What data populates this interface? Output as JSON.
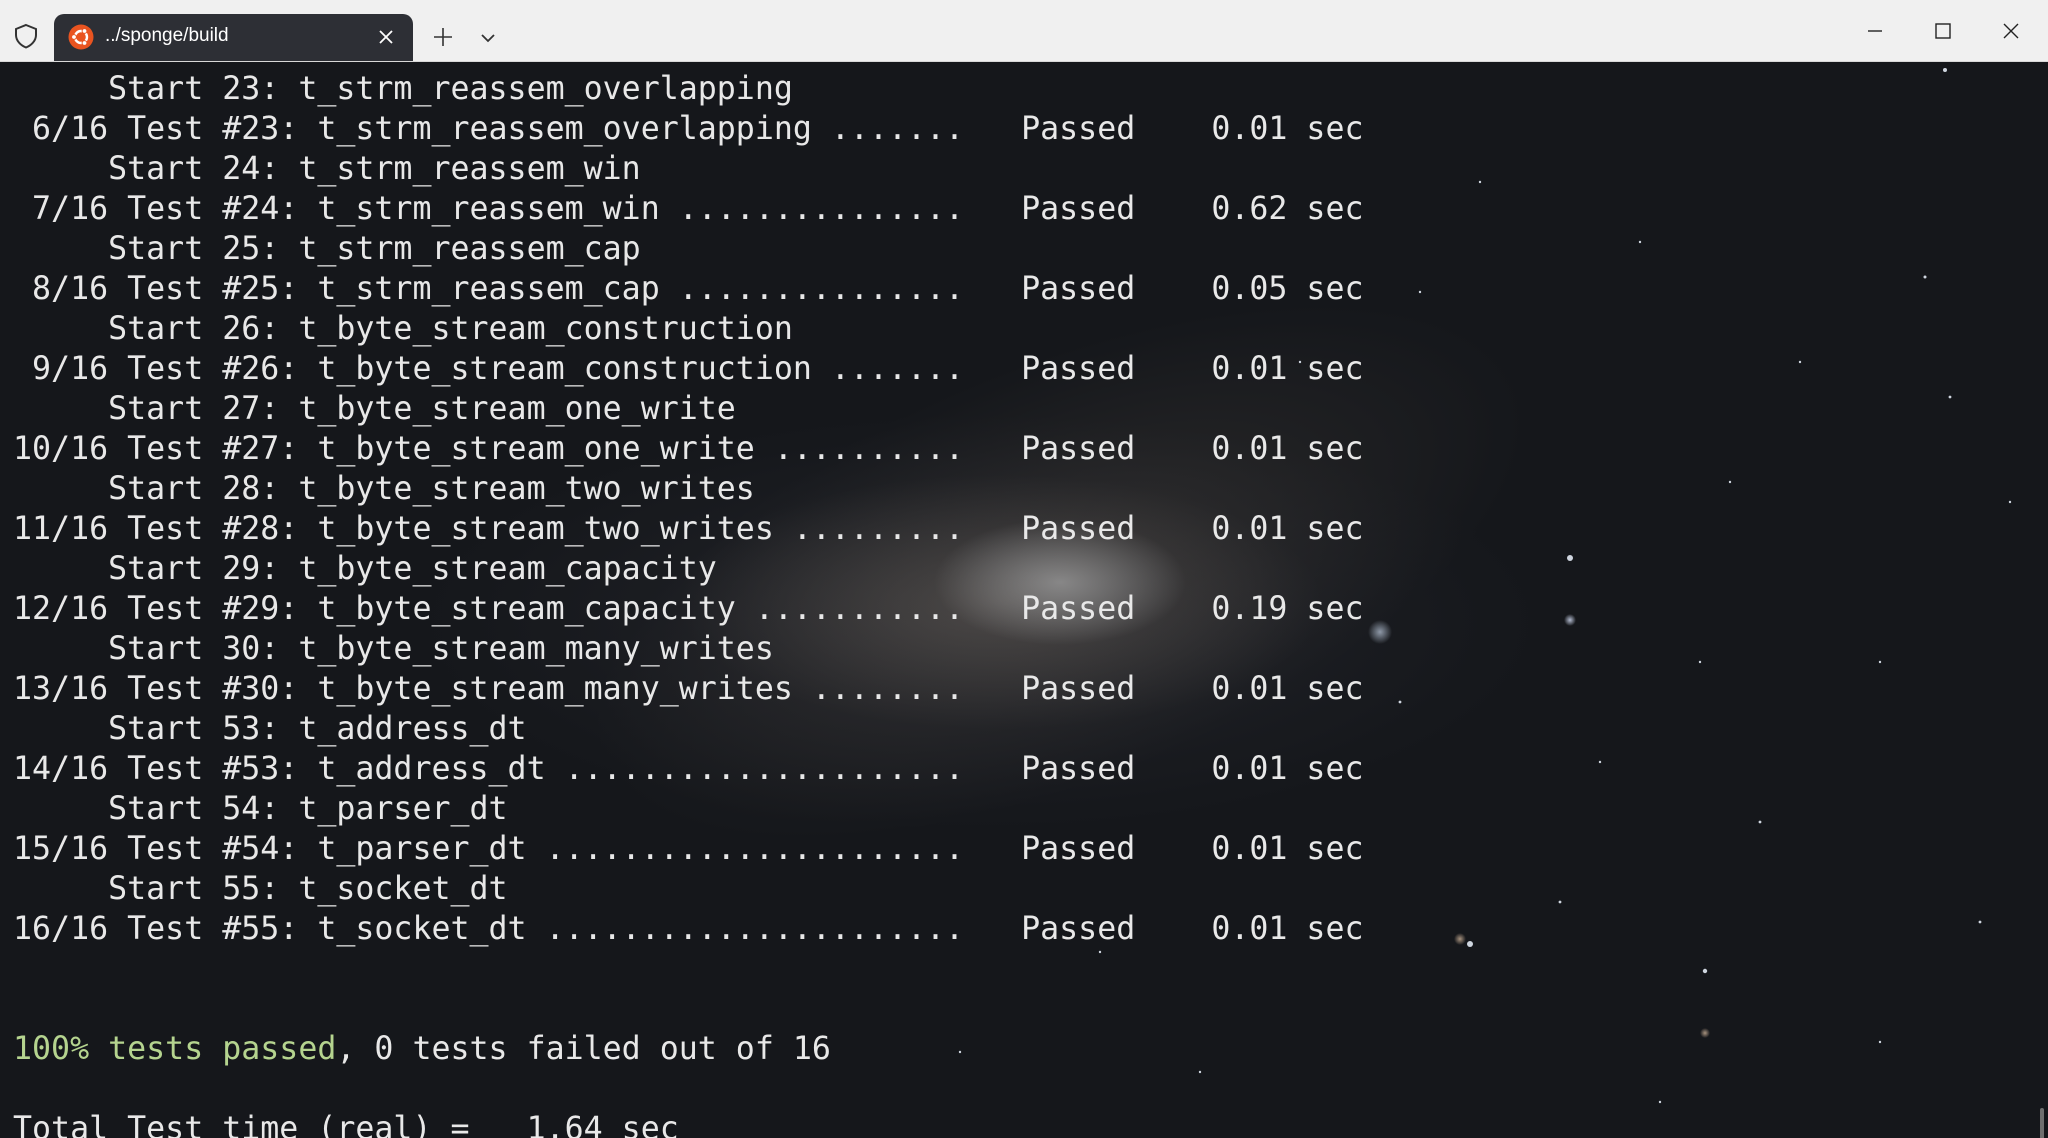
{
  "titlebar": {
    "tab_title": "../sponge/build",
    "tab_icon": "ubuntu-icon",
    "shield_icon": "shield-icon",
    "new_tab_icon": "plus-icon",
    "dropdown_icon": "chevron-down-icon",
    "minimize_icon": "minimize-icon",
    "maximize_icon": "maximize-icon",
    "close_icon": "close-icon"
  },
  "terminal": {
    "lines": [
      "     Start 23: t_strm_reassem_overlapping",
      " 6/16 Test #23: t_strm_reassem_overlapping .......   Passed    0.01 sec",
      "     Start 24: t_strm_reassem_win",
      " 7/16 Test #24: t_strm_reassem_win ...............   Passed    0.62 sec",
      "     Start 25: t_strm_reassem_cap",
      " 8/16 Test #25: t_strm_reassem_cap ...............   Passed    0.05 sec",
      "     Start 26: t_byte_stream_construction",
      " 9/16 Test #26: t_byte_stream_construction .......   Passed    0.01 sec",
      "     Start 27: t_byte_stream_one_write",
      "10/16 Test #27: t_byte_stream_one_write ..........   Passed    0.01 sec",
      "     Start 28: t_byte_stream_two_writes",
      "11/16 Test #28: t_byte_stream_two_writes .........   Passed    0.01 sec",
      "     Start 29: t_byte_stream_capacity",
      "12/16 Test #29: t_byte_stream_capacity ...........   Passed    0.19 sec",
      "     Start 30: t_byte_stream_many_writes",
      "13/16 Test #30: t_byte_stream_many_writes ........   Passed    0.01 sec",
      "     Start 53: t_address_dt",
      "14/16 Test #53: t_address_dt .....................   Passed    0.01 sec",
      "     Start 54: t_parser_dt",
      "15/16 Test #54: t_parser_dt ......................   Passed    0.01 sec",
      "     Start 55: t_socket_dt",
      "16/16 Test #55: t_socket_dt ......................   Passed    0.01 sec"
    ],
    "summary_green": "100% tests passed",
    "summary_rest": ", 0 tests failed out of 16",
    "total_line": "Total Test time (real) =   1.64 sec",
    "summary_color": "#b5d48f",
    "text_color": "#e8e8e8"
  }
}
